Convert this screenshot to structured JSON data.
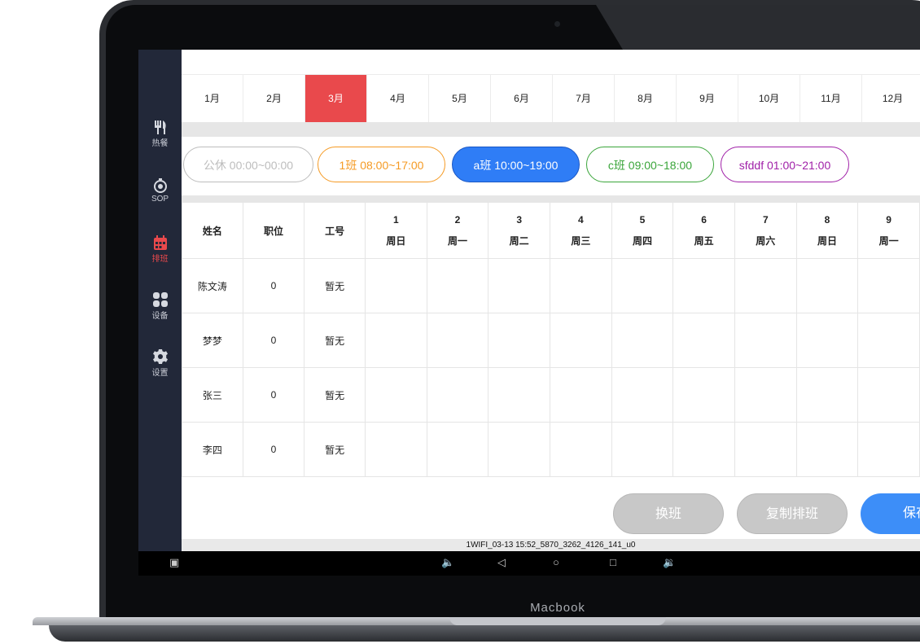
{
  "device_label": "Macbook",
  "sidebar": {
    "items": [
      {
        "label": "热餐",
        "icon": "fork-knife-icon"
      },
      {
        "label": "SOP",
        "icon": "stopwatch-icon"
      },
      {
        "label": "排班",
        "icon": "calendar-icon",
        "active": true
      },
      {
        "label": "设备",
        "icon": "grid-icon"
      },
      {
        "label": "设置",
        "icon": "gear-icon"
      }
    ]
  },
  "months": [
    "1月",
    "2月",
    "3月",
    "4月",
    "5月",
    "6月",
    "7月",
    "8月",
    "9月",
    "10月",
    "11月",
    "12月"
  ],
  "active_month": "3月",
  "shifts": [
    {
      "label": "公休 00:00~00:00",
      "color": "#bdbdbd",
      "filled": false
    },
    {
      "label": "1班 08:00~17:00",
      "color": "#f59a23",
      "filled": false
    },
    {
      "label": "a班 10:00~19:00",
      "color": "#2f7df6",
      "filled": true
    },
    {
      "label": "c班 09:00~18:00",
      "color": "#3aa53a",
      "filled": false
    },
    {
      "label": "sfddf 01:00~21:00",
      "color": "#a020a8",
      "filled": false
    }
  ],
  "table": {
    "headers": [
      "姓名",
      "职位",
      "工号"
    ],
    "days": [
      {
        "num": "1",
        "wk": "周日"
      },
      {
        "num": "2",
        "wk": "周一"
      },
      {
        "num": "3",
        "wk": "周二"
      },
      {
        "num": "4",
        "wk": "周三"
      },
      {
        "num": "5",
        "wk": "周四"
      },
      {
        "num": "6",
        "wk": "周五"
      },
      {
        "num": "7",
        "wk": "周六"
      },
      {
        "num": "8",
        "wk": "周日"
      },
      {
        "num": "9",
        "wk": "周一"
      }
    ],
    "rows": [
      {
        "name": "陈文涛",
        "position": "0",
        "id": "暂无"
      },
      {
        "name": "梦梦",
        "position": "0",
        "id": "暂无"
      },
      {
        "name": "张三",
        "position": "0",
        "id": "暂无"
      },
      {
        "name": "李四",
        "position": "0",
        "id": "暂无"
      }
    ]
  },
  "buttons": {
    "swap": "换班",
    "copy": "复制排班",
    "save": "保存"
  },
  "status_text": "1WIFI_03-13 15:52_5870_3262_4126_141_u0",
  "colors": {
    "accent_red": "#e9494c",
    "save_blue": "#3d8ef8",
    "sidebar_bg": "#222839",
    "disabled_btn": "#c8c8c8"
  }
}
